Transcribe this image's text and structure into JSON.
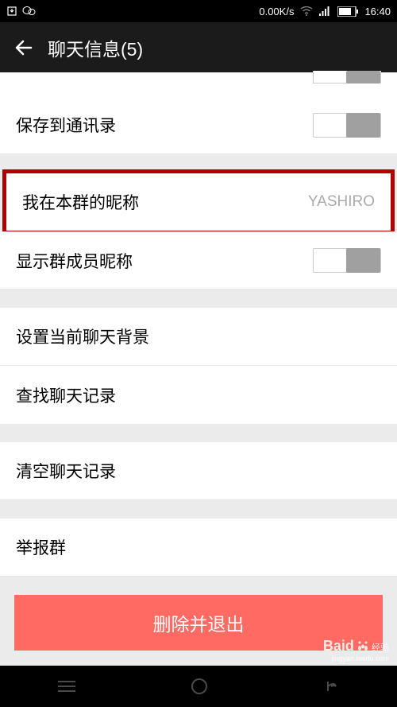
{
  "status": {
    "speed": "0.00K/s",
    "time": "16:40"
  },
  "header": {
    "title": "聊天信息(5)"
  },
  "rows": {
    "save_contacts": "保存到通讯录",
    "my_nickname_label": "我在本群的昵称",
    "my_nickname_value": "YASHIRO",
    "show_member_nick": "显示群成员昵称",
    "set_background": "设置当前聊天背景",
    "search_history": "查找聊天记录",
    "clear_history": "清空聊天记录",
    "report_group": "举报群"
  },
  "delete_button": "删除并退出",
  "watermark": {
    "brand": "Baid",
    "suffix": "经验",
    "url": "jingyan.baidu.com"
  }
}
